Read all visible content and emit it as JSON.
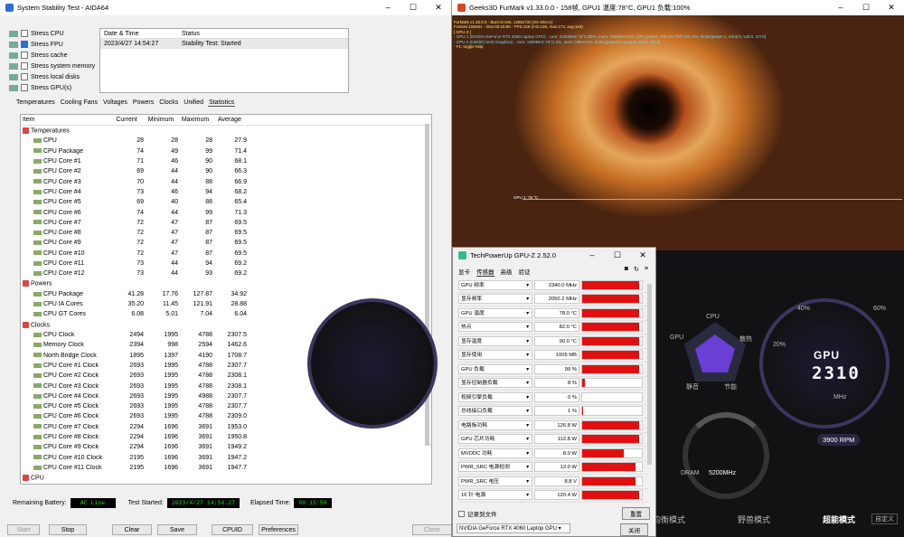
{
  "aida": {
    "title": "System Stability Test - AIDA64",
    "stress": [
      {
        "label": "Stress CPU",
        "checked": false
      },
      {
        "label": "Stress FPU",
        "checked": true
      },
      {
        "label": "Stress cache",
        "checked": false
      },
      {
        "label": "Stress system memory",
        "checked": false
      },
      {
        "label": "Stress local disks",
        "checked": false
      },
      {
        "label": "Stress GPU(s)",
        "checked": false
      }
    ],
    "status": {
      "h1": "Date & Time",
      "h2": "Status",
      "date": "2023/4/27 14:54:27",
      "state": "Stability Test: Started"
    },
    "tabs": [
      "Temperatures",
      "Cooling Fans",
      "Voltages",
      "Powers",
      "Clocks",
      "Unified",
      "Statistics"
    ],
    "cols": [
      "Item",
      "Current",
      "Minimum",
      "Maximum",
      "Average"
    ],
    "rows": [
      [
        "cat",
        "Temperatures",
        "",
        "",
        "",
        ""
      ],
      [
        "sub",
        "CPU",
        "28",
        "28",
        "28",
        "27.9"
      ],
      [
        "sub",
        "CPU Package",
        "74",
        "49",
        "99",
        "71.4"
      ],
      [
        "sub",
        "CPU Core #1",
        "71",
        "46",
        "90",
        "68.1"
      ],
      [
        "sub",
        "CPU Core #2",
        "69",
        "44",
        "90",
        "66.3"
      ],
      [
        "sub",
        "CPU Core #3",
        "70",
        "44",
        "88",
        "66.9"
      ],
      [
        "sub",
        "CPU Core #4",
        "73",
        "46",
        "94",
        "68.2"
      ],
      [
        "sub",
        "CPU Core #5",
        "69",
        "40",
        "88",
        "65.4"
      ],
      [
        "sub",
        "CPU Core #6",
        "74",
        "44",
        "99",
        "71.3"
      ],
      [
        "sub",
        "CPU Core #7",
        "72",
        "47",
        "87",
        "69.5"
      ],
      [
        "sub",
        "CPU Core #8",
        "72",
        "47",
        "87",
        "69.5"
      ],
      [
        "sub",
        "CPU Core #9",
        "72",
        "47",
        "87",
        "69.5"
      ],
      [
        "sub",
        "CPU Core #10",
        "72",
        "47",
        "87",
        "69.5"
      ],
      [
        "sub",
        "CPU Core #11",
        "73",
        "44",
        "94",
        "69.2"
      ],
      [
        "sub",
        "CPU Core #12",
        "73",
        "44",
        "93",
        "69.2"
      ],
      [
        "cat",
        "Powers",
        "",
        "",
        "",
        ""
      ],
      [
        "sub",
        "CPU Package",
        "41.28",
        "17.76",
        "127.87",
        "34.92"
      ],
      [
        "sub",
        "CPU IA Cores",
        "35.20",
        "11.45",
        "121.91",
        "28.88"
      ],
      [
        "sub",
        "CPU GT Cores",
        "6.08",
        "5.01",
        "7.04",
        "6.04"
      ],
      [
        "cat",
        "Clocks",
        "",
        "",
        "",
        ""
      ],
      [
        "sub",
        "CPU Clock",
        "2494",
        "1995",
        "4788",
        "2307.5"
      ],
      [
        "sub",
        "Memory Clock",
        "2394",
        "998",
        "2594",
        "1462.6"
      ],
      [
        "sub",
        "North Bridge Clock",
        "1895",
        "1397",
        "4190",
        "1708.7"
      ],
      [
        "sub",
        "CPU Core #1 Clock",
        "2693",
        "1995",
        "4788",
        "2307.7"
      ],
      [
        "sub",
        "CPU Core #2 Clock",
        "2693",
        "1995",
        "4788",
        "2308.1"
      ],
      [
        "sub",
        "CPU Core #3 Clock",
        "2693",
        "1995",
        "4788",
        "2308.1"
      ],
      [
        "sub",
        "CPU Core #4 Clock",
        "2693",
        "1995",
        "4988",
        "2307.7"
      ],
      [
        "sub",
        "CPU Core #5 Clock",
        "2693",
        "1995",
        "4788",
        "2307.7"
      ],
      [
        "sub",
        "CPU Core #6 Clock",
        "2693",
        "1995",
        "4788",
        "2309.0"
      ],
      [
        "sub",
        "CPU Core #7 Clock",
        "2294",
        "1696",
        "3691",
        "1953.0"
      ],
      [
        "sub",
        "CPU Core #8 Clock",
        "2294",
        "1696",
        "3691",
        "1950.8"
      ],
      [
        "sub",
        "CPU Core #9 Clock",
        "2294",
        "1696",
        "3691",
        "1949.2"
      ],
      [
        "sub",
        "CPU Core #10 Clock",
        "2195",
        "1696",
        "3691",
        "1947.2"
      ],
      [
        "sub",
        "CPU Core #11 Clock",
        "2195",
        "1696",
        "3691",
        "1947.7"
      ],
      [
        "cat",
        "CPU",
        "",
        "",
        "",
        ""
      ]
    ],
    "battery_label": "Remaining Battery:",
    "battery_value": "AC Line",
    "started_label": "Test Started:",
    "started_value": "2023/4/27 14:54:27",
    "elapsed_label": "Elapsed Time:",
    "elapsed_value": "00:15:58",
    "buttons": [
      "Start",
      "Stop",
      "Clear",
      "Save",
      "CPUID",
      "Preferences",
      "Close"
    ]
  },
  "furmark": {
    "title": "Geeks3D FurMark v1.33.0.0 - 158帧, GPU1 温度:78°C, GPU1 负载:100%",
    "hud": [
      "FurMark v1.33.0.0 - Burn-in test, 1280x720 (0X MSAA)",
      "Frames:158481 - time:00:15:56 - FPS:158 (min:136, max:173, avg:163)",
      "[ GPU-Z ]",
      "- GPU 1 (NVIDIA GeForce RTX 4060 Laptop GPU) - core: 2340MHz:78°C:99%, mem: 2050MHz:8%, GPU power: 100.0% TDP, fan: 0%, limits:[power:1, temp:0, volt:0, OV:0]",
      "- GPU 2 (Intel(R) UHD Graphics) - core: 1300MHz:78°C:2%, mem: 0MHz:0%, limits:[power:0, temp:0, volt:0, OV:0]",
      "- F1: toggle help"
    ],
    "graph_label": "GPU 1: 78 °C"
  },
  "dashboard": {
    "gpu_label": "GPU",
    "gpu_value": "2310",
    "gpu_unit": "MHz",
    "rpm_value": "3900 RPM",
    "cpu_label": "CPU",
    "gpu_small": "GPU",
    "sanre": "散热",
    "jingyin": "静音",
    "jieneng": "节能",
    "dram_label": "DRAM",
    "dram_value": "5200MHz",
    "p1": "40%",
    "p2": "60%",
    "p3": "20%",
    "modes": [
      "均衡模式",
      "野兽模式",
      "超能模式",
      "自定义"
    ]
  },
  "gpuz": {
    "title": "TechPowerUp GPU-Z 2.52.0",
    "tabs": [
      "显卡",
      "传感器",
      "高级",
      "验证"
    ],
    "sensors": [
      {
        "name": "GPU 频率",
        "value": "2340.0 MHz",
        "fill": 0.96
      },
      {
        "name": "显存频率",
        "value": "2050.2 MHz",
        "fill": 0.96
      },
      {
        "name": "GPU 温度",
        "value": "78.0 °C",
        "fill": 0.96
      },
      {
        "name": "热点",
        "value": "82.0 °C",
        "fill": 0.96
      },
      {
        "name": "显存温度",
        "value": "90.0 °C",
        "fill": 0.96
      },
      {
        "name": "显存使用",
        "value": "1005 MB",
        "fill": 0.96
      },
      {
        "name": "GPU 负载",
        "value": "99 %",
        "fill": 0.96
      },
      {
        "name": "显存控制器负载",
        "value": "8 %",
        "fill": 0.04
      },
      {
        "name": "视频引擎负载",
        "value": "0 %",
        "fill": 0
      },
      {
        "name": "总线接口负载",
        "value": "1 %",
        "fill": 0.02
      },
      {
        "name": "电路板功耗",
        "value": "126.8 W",
        "fill": 0.96
      },
      {
        "name": "GPU 芯片功耗",
        "value": "112.8 W",
        "fill": 0.96
      },
      {
        "name": "MVDDC 功耗",
        "value": "8.0 W",
        "fill": 0.7
      },
      {
        "name": "PWR_SRC 电源检测",
        "value": "12.0 W",
        "fill": 0.9
      },
      {
        "name": "PWR_SRC 电压",
        "value": "8.8 V",
        "fill": 0.9
      },
      {
        "name": "16 针 电源",
        "value": "120.4 W",
        "fill": 0.96
      }
    ],
    "log_label": "记录到文件",
    "reset": "重置",
    "device": "NVIDIA GeForce RTX 4060 Laptop GPU",
    "close": "关闭"
  }
}
